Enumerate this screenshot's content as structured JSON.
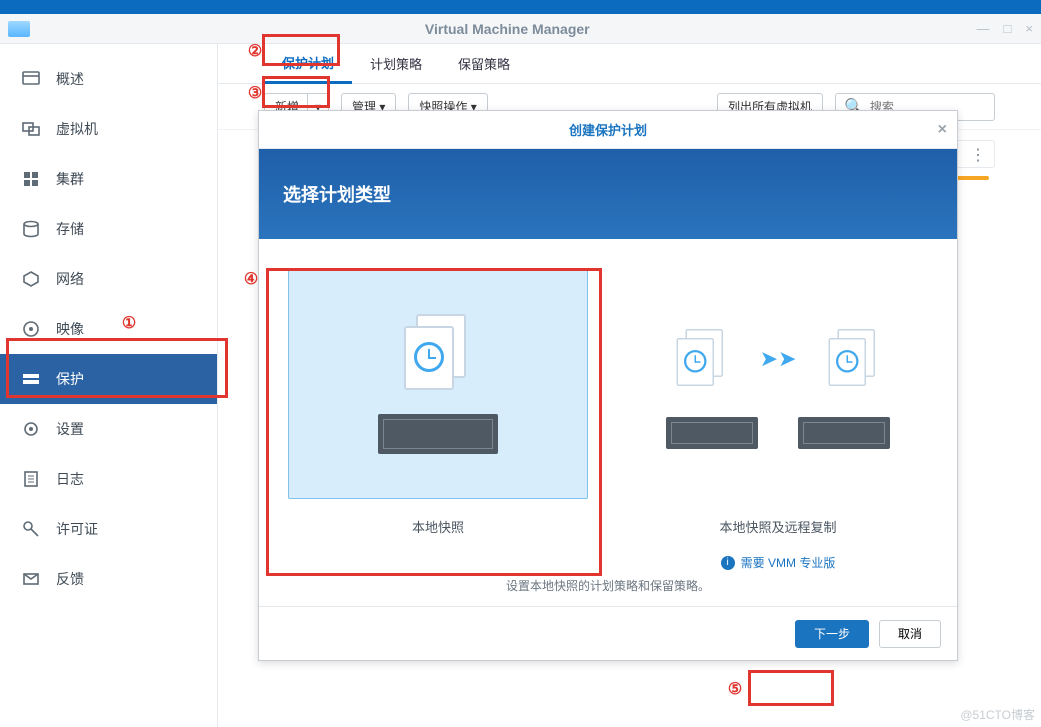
{
  "window": {
    "title": "Virtual Machine Manager",
    "controls": {
      "min": "—",
      "max": "□",
      "close": "×"
    }
  },
  "sidebar": {
    "items": [
      {
        "label": "概述",
        "icon": "overview"
      },
      {
        "label": "虚拟机",
        "icon": "vm"
      },
      {
        "label": "集群",
        "icon": "cluster"
      },
      {
        "label": "存储",
        "icon": "storage"
      },
      {
        "label": "网络",
        "icon": "network"
      },
      {
        "label": "映像",
        "icon": "image"
      },
      {
        "label": "保护",
        "icon": "protect",
        "active": true
      },
      {
        "label": "设置",
        "icon": "settings"
      },
      {
        "label": "日志",
        "icon": "log"
      },
      {
        "label": "许可证",
        "icon": "license"
      },
      {
        "label": "反馈",
        "icon": "feedback"
      }
    ]
  },
  "tabs": {
    "items": [
      {
        "label": "保护计划",
        "active": true
      },
      {
        "label": "计划策略"
      },
      {
        "label": "保留策略"
      }
    ]
  },
  "toolbar": {
    "add": "新增",
    "manage": "管理",
    "snapshot_ops": "快照操作",
    "list_all": "列出所有虚拟机",
    "search_placeholder": "搜索"
  },
  "dialog": {
    "title": "创建保护计划",
    "hero": "选择计划类型",
    "options": [
      {
        "label": "本地快照",
        "selected": true
      },
      {
        "label": "本地快照及远程复制",
        "pro_note": "需要 VMM 专业版"
      }
    ],
    "description": "设置本地快照的计划策略和保留策略。",
    "next": "下一步",
    "cancel": "取消"
  },
  "callouts": [
    "①",
    "②",
    "③",
    "④",
    "⑤"
  ],
  "watermark": "@51CTO博客"
}
